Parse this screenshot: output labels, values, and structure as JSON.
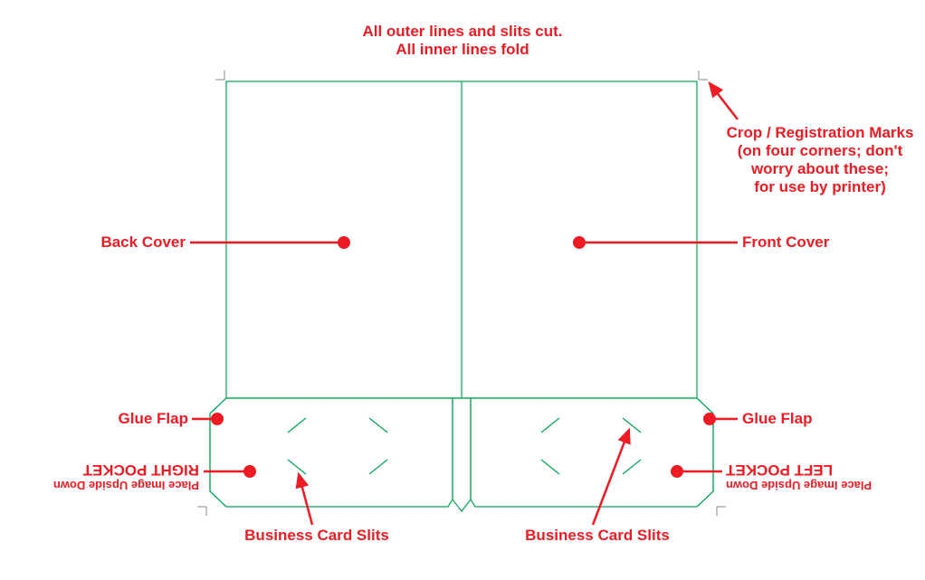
{
  "header": {
    "line1": "All outer lines and slits cut.",
    "line2": "All inner lines fold"
  },
  "labels": {
    "crop_marks_l1": "Crop / Registration Marks",
    "crop_marks_l2": "(on four corners; don't",
    "crop_marks_l3": "worry about these;",
    "crop_marks_l4": "for use by printer)",
    "back_cover": "Back Cover",
    "front_cover": "Front Cover",
    "glue_flap_left": "Glue Flap",
    "glue_flap_right": "Glue Flap",
    "right_pocket": "RIGHT POCKET",
    "right_pocket_sub": "Place Image Upside Down",
    "left_pocket": "LEFT POCKET",
    "left_pocket_sub": "Place Image Upside Down",
    "card_slits_left": "Business Card Slits",
    "card_slits_right": "Business Card Slits"
  },
  "dieline": {
    "type": "presentation-folder",
    "panels": [
      "back-cover",
      "front-cover",
      "right-pocket",
      "left-pocket",
      "glue-flap-left",
      "glue-flap-right"
    ],
    "features": [
      "business-card-slits",
      "crop-marks",
      "center-fold"
    ]
  }
}
